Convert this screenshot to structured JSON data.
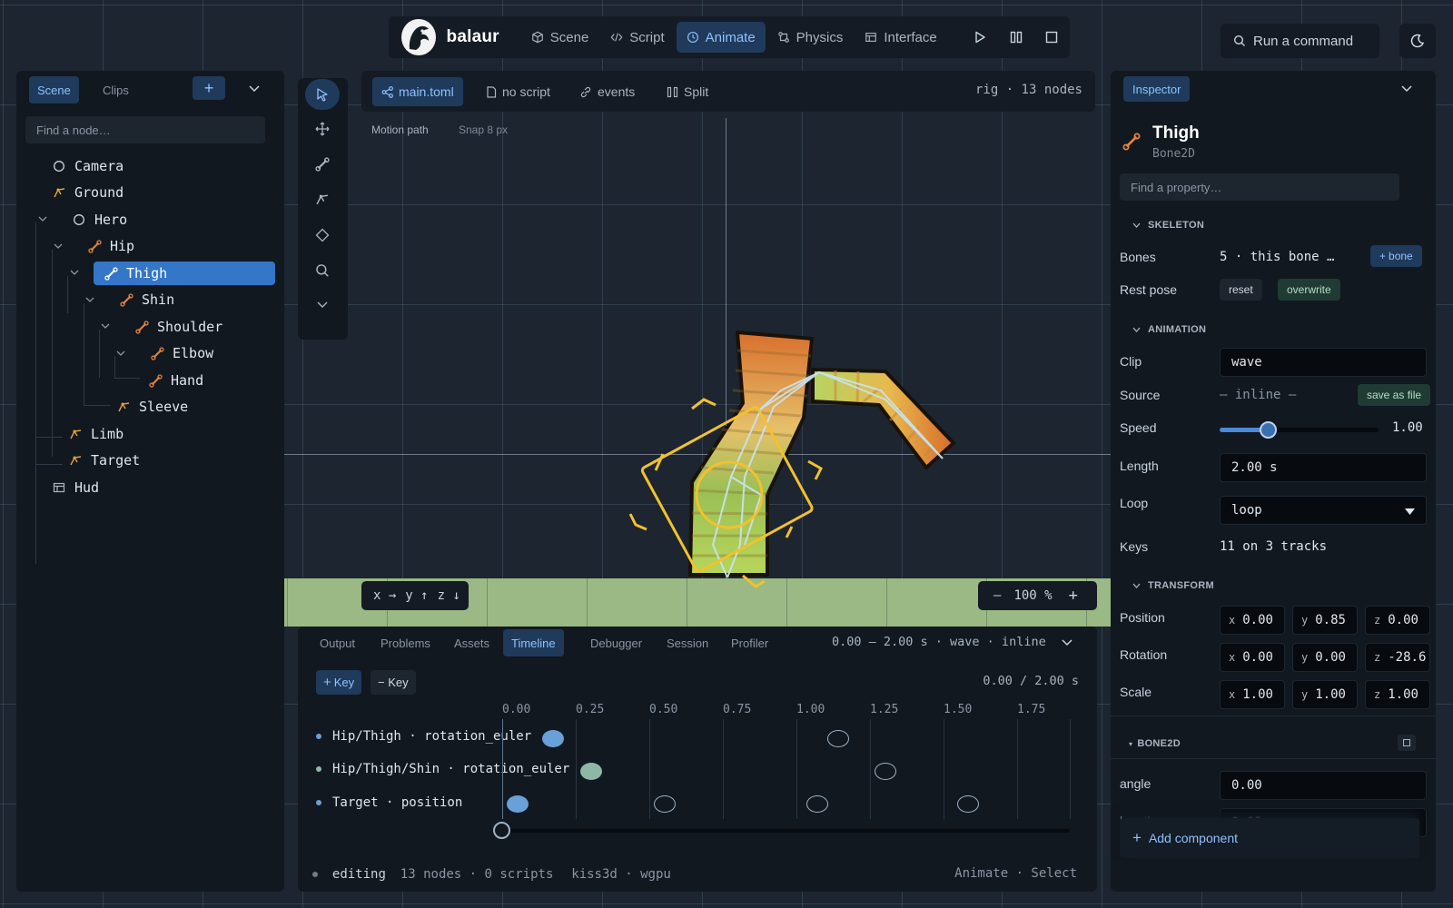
{
  "topbar": {
    "brand": "balaur",
    "tabs": [
      {
        "label": "Scene",
        "icon": "cube-icon"
      },
      {
        "label": "Script",
        "icon": "code-icon"
      },
      {
        "label": "Animate",
        "icon": "clock-icon",
        "active": true
      },
      {
        "label": "Physics",
        "icon": "physics-icon"
      },
      {
        "label": "Interface",
        "icon": "layout-icon"
      }
    ],
    "controls": [
      "play-icon",
      "pause-icon",
      "stop-icon"
    ],
    "command_placeholder": "Run a command",
    "theme_icon": "moon-icon"
  },
  "scene_panel": {
    "tabs": [
      "Scene",
      "Clips"
    ],
    "active_tab": "Scene",
    "add_label": "+",
    "search_placeholder": "Find a node…",
    "tree": [
      {
        "label": "Camera",
        "icon": "circle-icon"
      },
      {
        "label": "Ground",
        "icon": "joint-icon"
      },
      {
        "label": "Hero",
        "icon": "circle-icon",
        "expanded": true
      },
      {
        "label": "Hip",
        "icon": "bone-icon",
        "expanded": true
      },
      {
        "label": "Thigh",
        "icon": "bone-icon",
        "expanded": true,
        "selected": true
      },
      {
        "label": "Shin",
        "icon": "bone-icon",
        "expanded": true
      },
      {
        "label": "Shoulder",
        "icon": "bone-icon",
        "expanded": true
      },
      {
        "label": "Elbow",
        "icon": "bone-icon",
        "expanded": true
      },
      {
        "label": "Hand",
        "icon": "bone-icon"
      },
      {
        "label": "Sleeve",
        "icon": "joint-icon"
      },
      {
        "label": "Limb",
        "icon": "joint-icon"
      },
      {
        "label": "Target",
        "icon": "joint-icon"
      },
      {
        "label": "Hud",
        "icon": "layout-icon"
      }
    ]
  },
  "tools": [
    "select-icon",
    "move-icon",
    "bone-icon",
    "joint-icon",
    "diamond-icon",
    "search-icon",
    "chevron-down-icon"
  ],
  "viewport": {
    "tabs": [
      {
        "label": "main.toml",
        "icon": "graph-icon",
        "active": true
      },
      {
        "label": "no script",
        "icon": "file-icon"
      },
      {
        "label": "events",
        "icon": "link-icon"
      },
      {
        "label": "Split",
        "icon": "columns-icon"
      }
    ],
    "info": "rig · 13 nodes",
    "motion_path": "Motion path",
    "snap": "Snap 8 px",
    "axes": {
      "x": "x →",
      "y": "y ↑",
      "z": "z ↓"
    },
    "zoom": {
      "minus": "–",
      "value": "100 %",
      "plus": "+"
    }
  },
  "bottom_panel": {
    "tabs": [
      "Output",
      "Problems",
      "Assets",
      "Timeline",
      "Debugger",
      "Session",
      "Profiler"
    ],
    "active_tab": "Timeline",
    "clip_info": "0.00 – 2.00 s · wave · inline",
    "key_add": "Key",
    "key_remove": "− Key",
    "time_readout": "0.00 / 2.00 s",
    "ticks": [
      "0.00",
      "0.25",
      "0.50",
      "0.75",
      "1.00",
      "1.25",
      "1.50",
      "1.75"
    ],
    "tracks": [
      {
        "label": "Hip/Thigh · rotation_euler",
        "keys": [
          0.12,
          1.09
        ]
      },
      {
        "label": "Hip/Thigh/Shin · rotation_euler",
        "keys": [
          0.25,
          1.25
        ]
      },
      {
        "label": "Target · position",
        "keys": [
          0.0,
          0.5,
          1.02,
          1.53
        ]
      }
    ],
    "scrub_time": 0.0,
    "status": {
      "mode": "editing",
      "counts": "13 nodes · 0 scripts",
      "backend": "kiss3d · wgpu",
      "right": "Animate · Select"
    }
  },
  "inspector": {
    "tab": "Inspector",
    "node_name": "Thigh",
    "node_type": "Bone2D",
    "search_placeholder": "Find a property…",
    "skeleton": {
      "header": "SKELETON",
      "bones_label": "Bones",
      "bones_value": "5 · this bone …",
      "bone_button": "bone",
      "rest_pose_label": "Rest pose",
      "reset": "reset",
      "overwrite": "overwrite"
    },
    "animation": {
      "header": "ANIMATION",
      "clip_label": "Clip",
      "clip_value": "wave",
      "source_label": "Source",
      "source_value": "— inline —",
      "save_as_file": "save as file",
      "speed_label": "Speed",
      "speed_value": "1.00",
      "speed_fraction": 0.31,
      "length_label": "Length",
      "length_value": "2.00 s",
      "loop_label": "Loop",
      "loop_value": "loop",
      "keys_label": "Keys",
      "keys_value": "11 on 3 tracks"
    },
    "transform": {
      "header": "TRANSFORM",
      "position_label": "Position",
      "position": {
        "x": "0.00",
        "y": "0.85",
        "z": "0.00"
      },
      "rotation_label": "Rotation",
      "rotation": {
        "x": "0.00",
        "y": "0.00",
        "z": "-28.6"
      },
      "scale_label": "Scale",
      "scale": {
        "x": "1.00",
        "y": "1.00",
        "z": "1.00"
      }
    },
    "bone2d": {
      "header": "BONE2D",
      "angle_label": "angle",
      "angle_value": "0.00",
      "length_label": "length",
      "length_value": "0.85"
    },
    "add_component": "Add component"
  },
  "colors": {
    "accent": "#3476c8",
    "accent_text": "#8fc1ff",
    "bone_orange": "#e8833a",
    "gizmo_yellow": "#f2c12e",
    "keyframe_blue": "#6aa0d8",
    "keyframe_green": "#8fb7a7"
  }
}
